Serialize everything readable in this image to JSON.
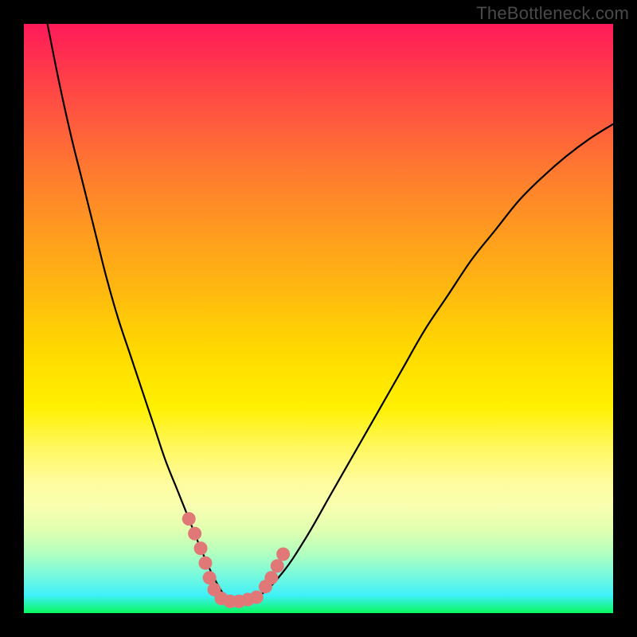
{
  "watermark": "TheBottleneck.com",
  "chart_data": {
    "type": "line",
    "title": "",
    "xlabel": "",
    "ylabel": "",
    "xlim": [
      0,
      100
    ],
    "ylim": [
      0,
      100
    ],
    "grid": false,
    "series": [
      {
        "name": "bottleneck-curve",
        "x": [
          4,
          6,
          8,
          10,
          12,
          14,
          16,
          18,
          20,
          22,
          24,
          26,
          28,
          30,
          32,
          34,
          35,
          36,
          40,
          44,
          48,
          52,
          56,
          60,
          64,
          68,
          72,
          76,
          80,
          84,
          88,
          92,
          96,
          100
        ],
        "values": [
          100,
          90,
          81,
          73,
          65,
          57,
          50,
          44,
          38,
          32,
          26,
          21,
          16,
          11,
          6.5,
          3,
          2,
          2,
          3,
          7,
          13,
          20,
          27,
          34,
          41,
          48,
          54,
          60,
          65,
          70,
          74,
          77.5,
          80.5,
          83
        ]
      }
    ],
    "markers": {
      "name": "highlight-points",
      "color": "#e07878",
      "points": [
        {
          "x": 28.0,
          "y": 16.0
        },
        {
          "x": 29.0,
          "y": 13.5
        },
        {
          "x": 30.0,
          "y": 11.0
        },
        {
          "x": 30.8,
          "y": 8.5
        },
        {
          "x": 31.5,
          "y": 6.0
        },
        {
          "x": 32.3,
          "y": 4.0
        },
        {
          "x": 33.5,
          "y": 2.5
        },
        {
          "x": 35.0,
          "y": 2.0
        },
        {
          "x": 36.5,
          "y": 2.0
        },
        {
          "x": 38.0,
          "y": 2.3
        },
        {
          "x": 39.5,
          "y": 2.7
        },
        {
          "x": 41.0,
          "y": 4.5
        },
        {
          "x": 42.0,
          "y": 6.0
        },
        {
          "x": 43.0,
          "y": 8.0
        },
        {
          "x": 44.0,
          "y": 10.0
        }
      ]
    },
    "background_gradient": {
      "top": "#ff1a5a",
      "mid": "#fff000",
      "bottom": "#08f85e"
    }
  }
}
